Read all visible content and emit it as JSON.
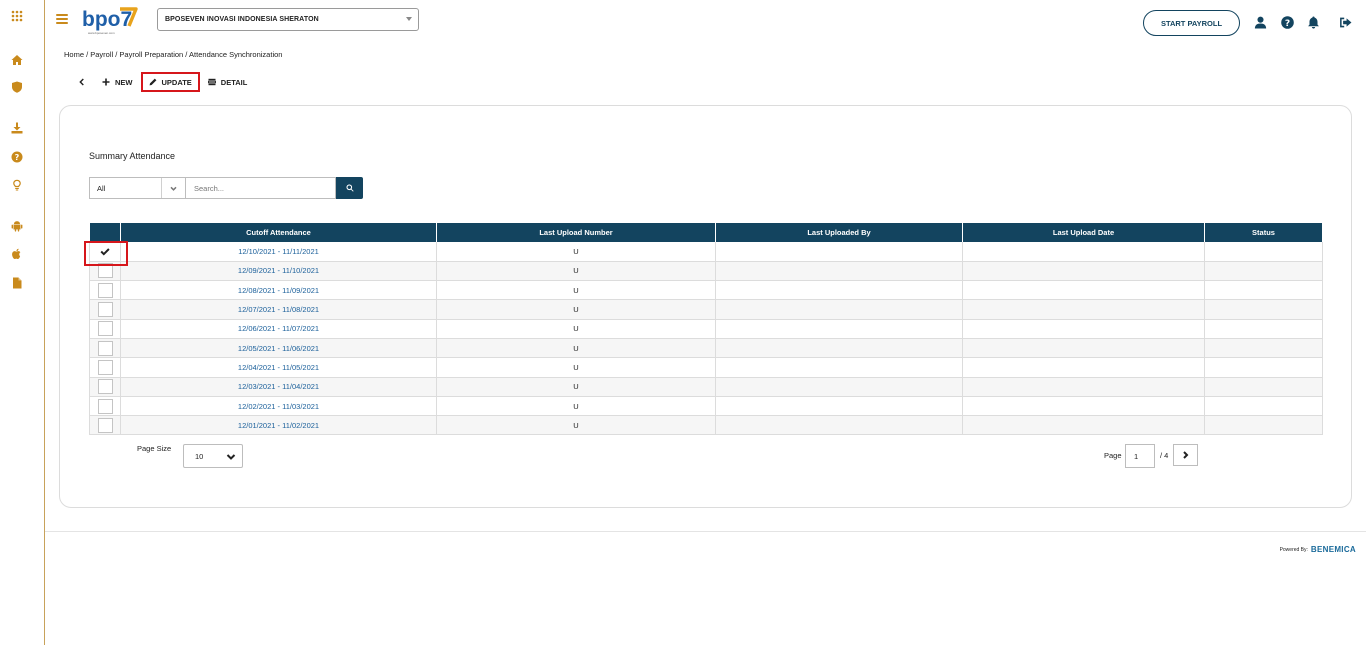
{
  "app": {
    "logo_text": "bpo7",
    "logo_tagline": "www.bposeven.com",
    "company": "BPOSEVEN INOVASI INDONESIA SHERATON",
    "start_payroll": "START PAYROLL",
    "brand_colors": {
      "primary": "#13445f",
      "accent": "#c98a1c",
      "highlight": "#d6161b"
    }
  },
  "sidebar": {
    "icons": [
      "apps-grid-icon",
      "home-icon",
      "shield-icon",
      "download-icon",
      "help-icon",
      "lightbulb-icon",
      "android-icon",
      "apple-icon",
      "document-icon"
    ]
  },
  "header_icons": [
    "user-icon",
    "help-icon",
    "bell-icon",
    "logout-icon"
  ],
  "breadcrumb": "Home / Payroll / Payroll Preparation / Attendance Synchronization",
  "toolbar": {
    "new_label": "NEW",
    "update_label": "UPDATE",
    "detail_label": "DETAIL"
  },
  "summary": {
    "title": "Summary Attendance",
    "filter_value": "All",
    "search_placeholder": "Search..."
  },
  "table": {
    "columns": [
      "Cutoff Attendance",
      "Last Upload Number",
      "Last Uploaded By",
      "Last Upload Date",
      "Status"
    ],
    "rows": [
      {
        "checked": true,
        "cutoff": "12/10/2021 - 11/11/2021",
        "upload_number": "U",
        "uploaded_by": "",
        "upload_date": "",
        "status": ""
      },
      {
        "checked": false,
        "cutoff": "12/09/2021 - 11/10/2021",
        "upload_number": "U",
        "uploaded_by": "",
        "upload_date": "",
        "status": ""
      },
      {
        "checked": false,
        "cutoff": "12/08/2021 - 11/09/2021",
        "upload_number": "U",
        "uploaded_by": "",
        "upload_date": "",
        "status": ""
      },
      {
        "checked": false,
        "cutoff": "12/07/2021 - 11/08/2021",
        "upload_number": "U",
        "uploaded_by": "",
        "upload_date": "",
        "status": ""
      },
      {
        "checked": false,
        "cutoff": "12/06/2021 - 11/07/2021",
        "upload_number": "U",
        "uploaded_by": "",
        "upload_date": "",
        "status": ""
      },
      {
        "checked": false,
        "cutoff": "12/05/2021 - 11/06/2021",
        "upload_number": "U",
        "uploaded_by": "",
        "upload_date": "",
        "status": ""
      },
      {
        "checked": false,
        "cutoff": "12/04/2021 - 11/05/2021",
        "upload_number": "U",
        "uploaded_by": "",
        "upload_date": "",
        "status": ""
      },
      {
        "checked": false,
        "cutoff": "12/03/2021 - 11/04/2021",
        "upload_number": "U",
        "uploaded_by": "",
        "upload_date": "",
        "status": ""
      },
      {
        "checked": false,
        "cutoff": "12/02/2021 - 11/03/2021",
        "upload_number": "U",
        "uploaded_by": "",
        "upload_date": "",
        "status": ""
      },
      {
        "checked": false,
        "cutoff": "12/01/2021 - 11/02/2021",
        "upload_number": "U",
        "uploaded_by": "",
        "upload_date": "",
        "status": ""
      }
    ]
  },
  "pagination": {
    "page_size_label": "Page Size",
    "page_size": "10",
    "page_label": "Page",
    "current_page": "1",
    "total_pages": "/ 4"
  },
  "footer": {
    "powered_by": "Powered By:",
    "brand": "BENEMICA"
  }
}
